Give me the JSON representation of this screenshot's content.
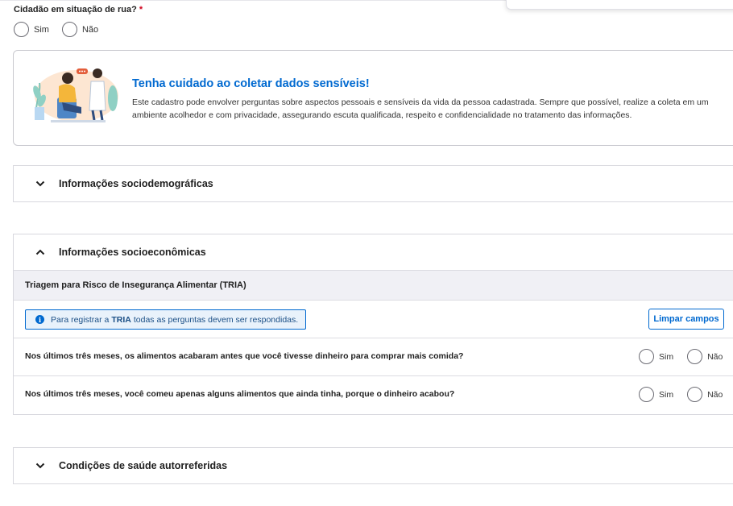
{
  "street": {
    "label": "Cidadão em situação de rua?",
    "required_mark": "*",
    "options": [
      "Sim",
      "Não"
    ]
  },
  "notice": {
    "title": "Tenha cuidado ao coletar dados sensíveis!",
    "text": "Este cadastro pode envolver perguntas sobre aspectos pessoais e sensíveis da vida da pessoa cadastrada. Sempre que possível, realize a coleta em um ambiente acolhedor e com privacidade, assegurando escuta qualificada, respeito e confidencialidade no tratamento das informações."
  },
  "sections": {
    "sociodemograficas": {
      "title": "Informações sociodemográficas",
      "icon": "chevron-down-icon"
    },
    "socioeconomicas": {
      "title": "Informações socioeconômicas",
      "icon": "chevron-up-icon"
    },
    "saude": {
      "title": "Condições de saúde autorreferidas",
      "icon": "chevron-down-icon"
    }
  },
  "tria": {
    "heading": "Triagem para Risco de Insegurança Alimentar (TRIA)",
    "alert_prefix": "Para registrar a",
    "alert_bold": "TRIA",
    "alert_suffix": "todas as perguntas devem ser respondidas.",
    "clear_button": "Limpar campos",
    "questions": [
      {
        "text": "Nos últimos três meses, os alimentos acabaram antes que você tivesse dinheiro para comprar mais comida?",
        "yes": "Sim",
        "no": "Não"
      },
      {
        "text": "Nos últimos três meses, você comeu apenas alguns alimentos que ainda tinha, porque o dinheiro acabou?",
        "yes": "Sim",
        "no": "Não"
      }
    ]
  },
  "colors": {
    "accent": "#0069d0",
    "required": "#d0021b",
    "tria_header_bg": "#f0f0f5",
    "alert_bg": "#e9f2fb"
  }
}
